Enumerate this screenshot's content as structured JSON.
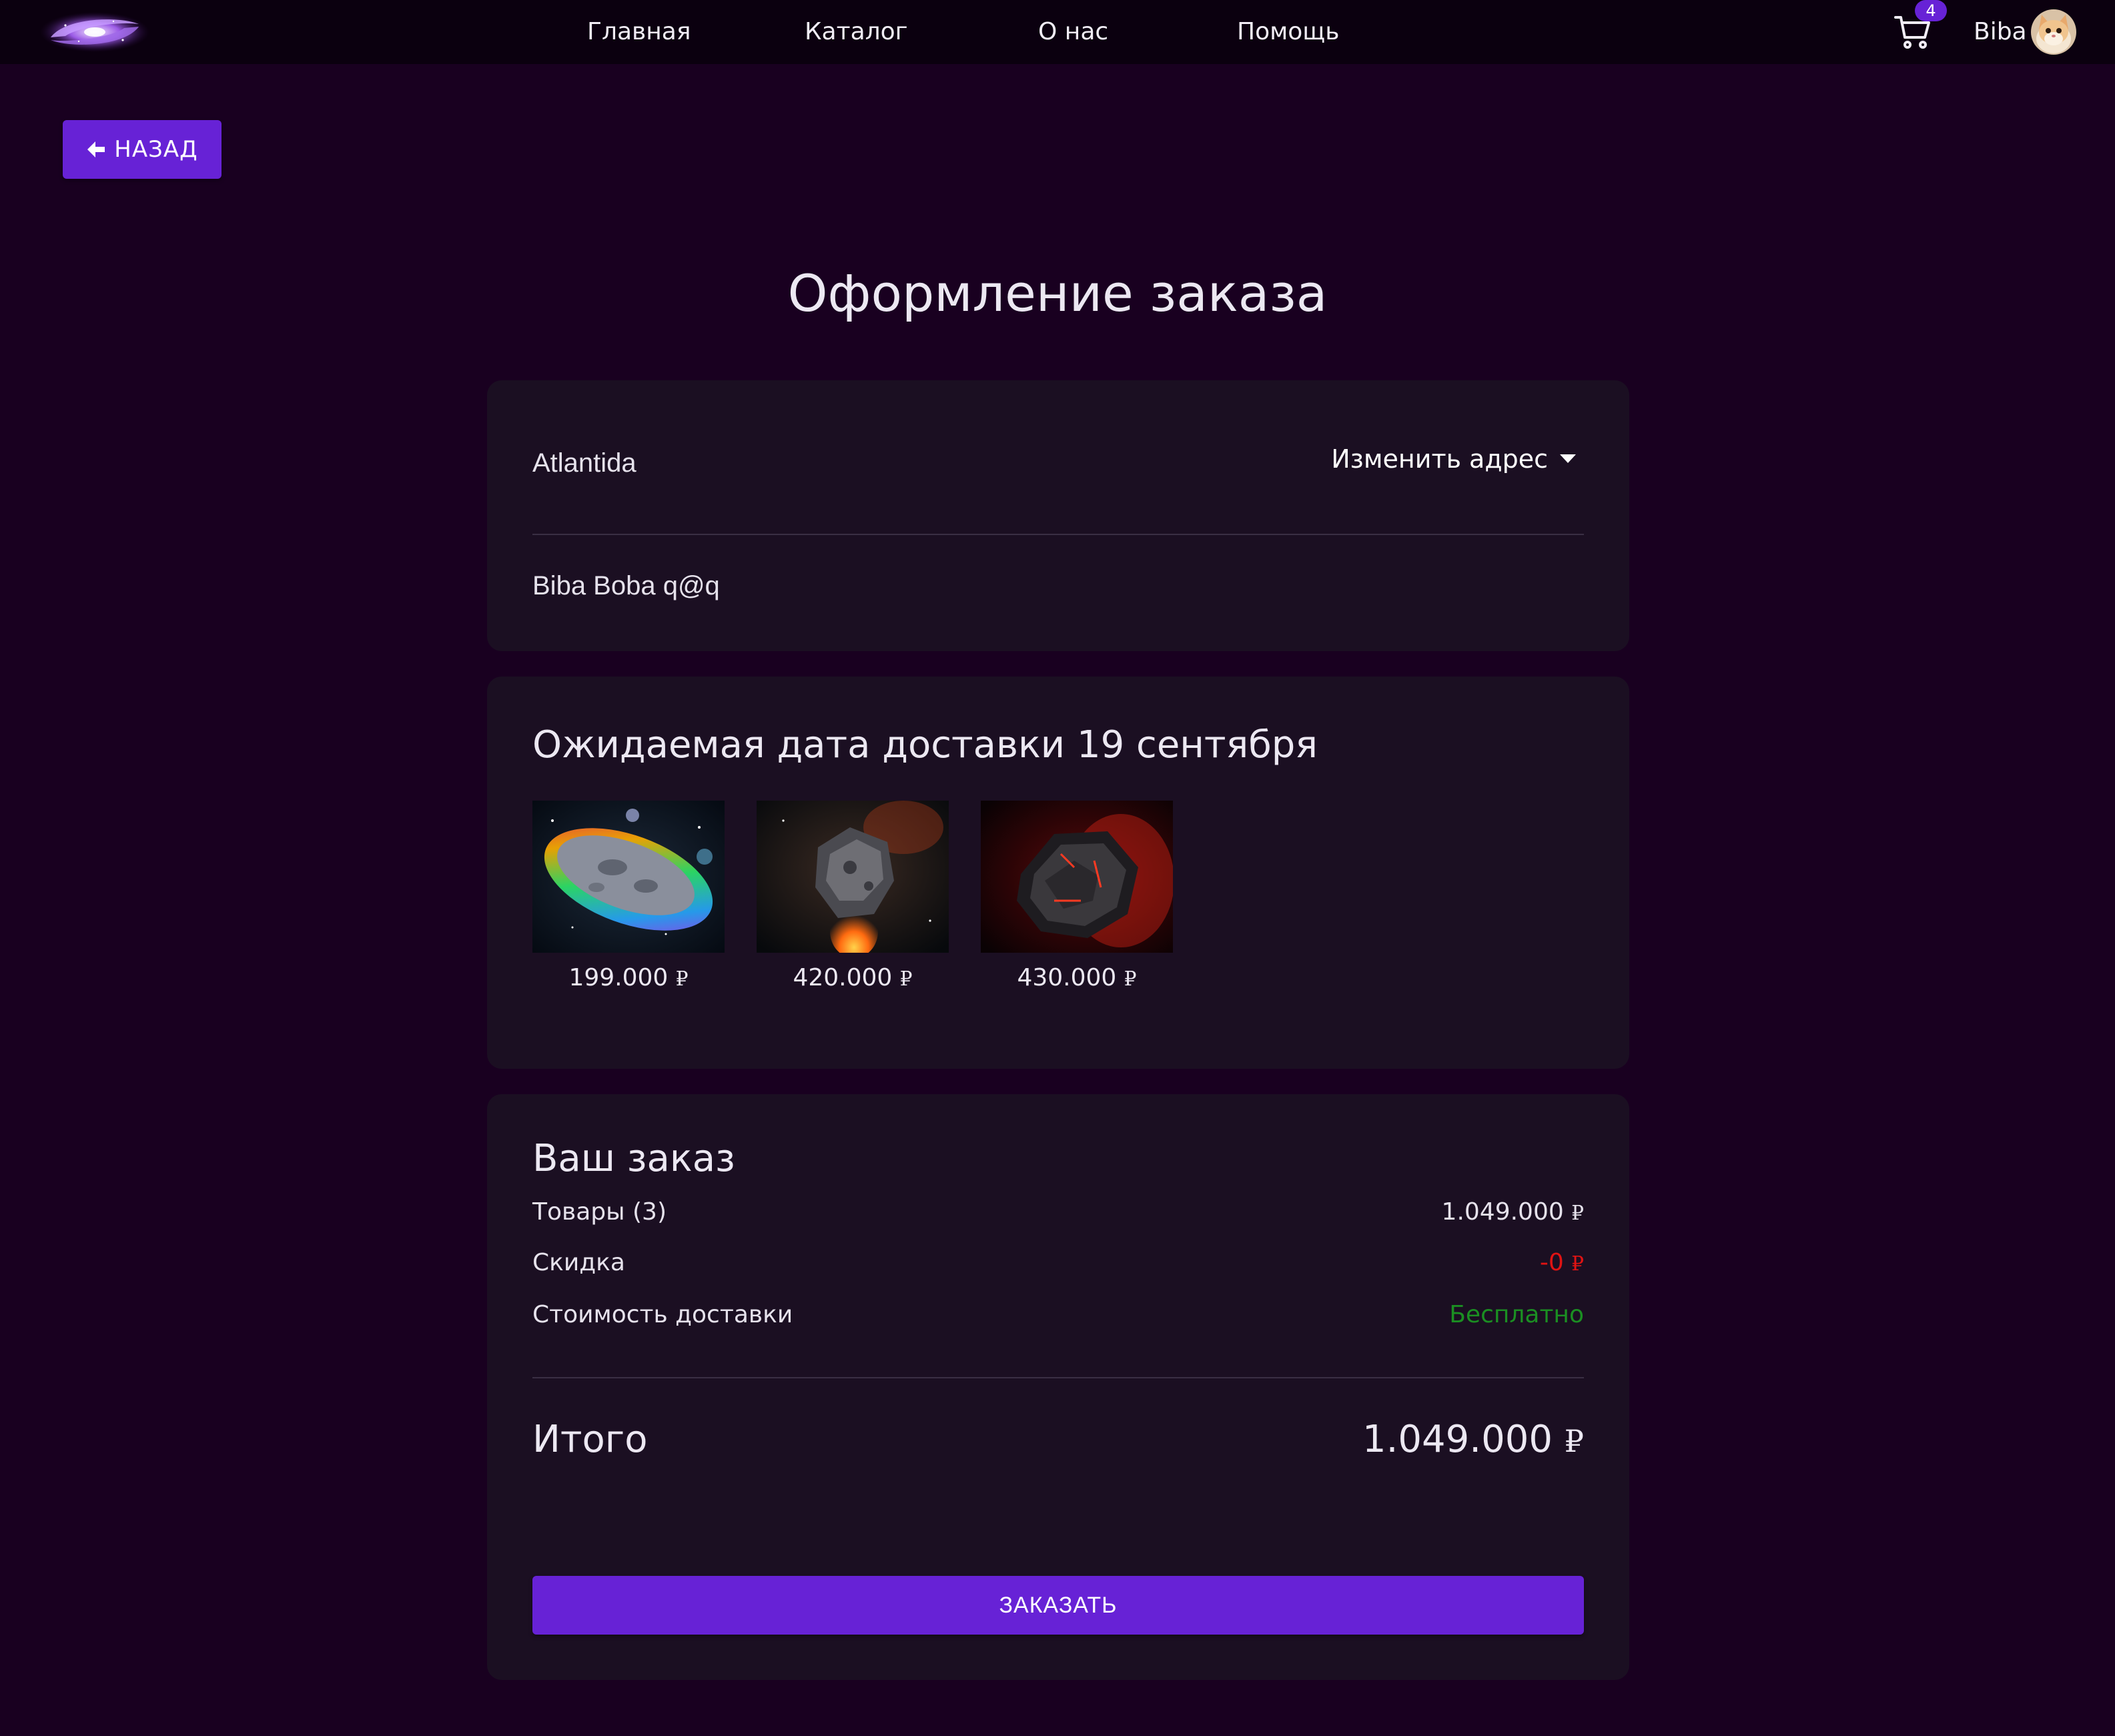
{
  "nav": {
    "logo_icon": "galaxy-logo-icon",
    "links": [
      "Главная",
      "Каталог",
      "О нас",
      "Помощь"
    ],
    "cart_icon": "shopping-cart-icon",
    "cart_count": "4",
    "username": "Biba",
    "avatar_icon": "cat-avatar-icon"
  },
  "back_button": {
    "label": "НАЗАД",
    "icon": "arrow-left-icon"
  },
  "page_title": "Оформление заказа",
  "address": {
    "value": "Atlantida",
    "change_label": "Изменить адрес",
    "change_icon": "caret-down-icon",
    "recipient": "Biba Boba q@q"
  },
  "delivery": {
    "title": "Ожидаемая дата доставки 19 сентября",
    "items": [
      {
        "image": "rainbow-asteroid-image",
        "price": "199.000",
        "currency": "₽"
      },
      {
        "image": "fiery-asteroid-image",
        "price": "420.000",
        "currency": "₽"
      },
      {
        "image": "red-lava-asteroid-image",
        "price": "430.000",
        "currency": "₽"
      }
    ]
  },
  "order": {
    "title": "Ваш заказ",
    "items_label": "Товары (3)",
    "items_value": "1.049.000",
    "discount_label": "Скидка",
    "discount_value": "-0",
    "shipping_label": "Стоимость доставки",
    "shipping_value": "Бесплатно",
    "total_label": "Итого",
    "total_value": "1.049.000",
    "currency": "₽",
    "submit_label": "ЗАКАЗАТЬ"
  },
  "colors": {
    "background": "#190020",
    "header": "#0b000f",
    "card": "#1b0f22",
    "accent": "#6722d6",
    "discount": "#e01313",
    "free_shipping": "#1b8f22"
  }
}
